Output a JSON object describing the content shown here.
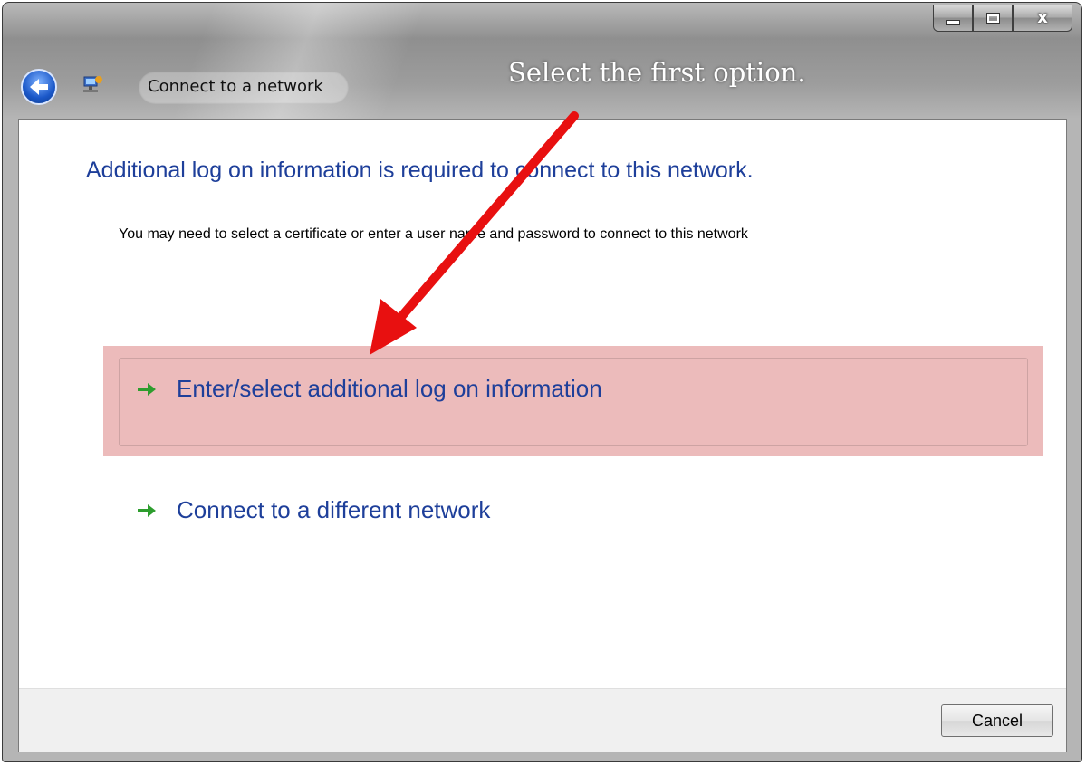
{
  "window": {
    "title": "Connect to a network",
    "caption_buttons": {
      "minimize": "minimize",
      "maximize": "maximize",
      "close": "x"
    }
  },
  "annotation": {
    "text": "Select the first option.",
    "color": "#ff0000"
  },
  "dialog": {
    "heading": "Additional log on information is required to connect to this network.",
    "description": "You may need to select a certificate or enter a user name and password to connect to this network",
    "options": [
      {
        "label": "Enter/select additional log on information",
        "icon": "green-arrow-icon",
        "highlighted": true
      },
      {
        "label": "Connect to a different network",
        "icon": "green-arrow-icon",
        "highlighted": false
      }
    ],
    "cancel_label": "Cancel"
  },
  "colors": {
    "heading": "#1e3f9a",
    "highlight": "#e29696",
    "arrow_green": "#2e9d2e"
  }
}
